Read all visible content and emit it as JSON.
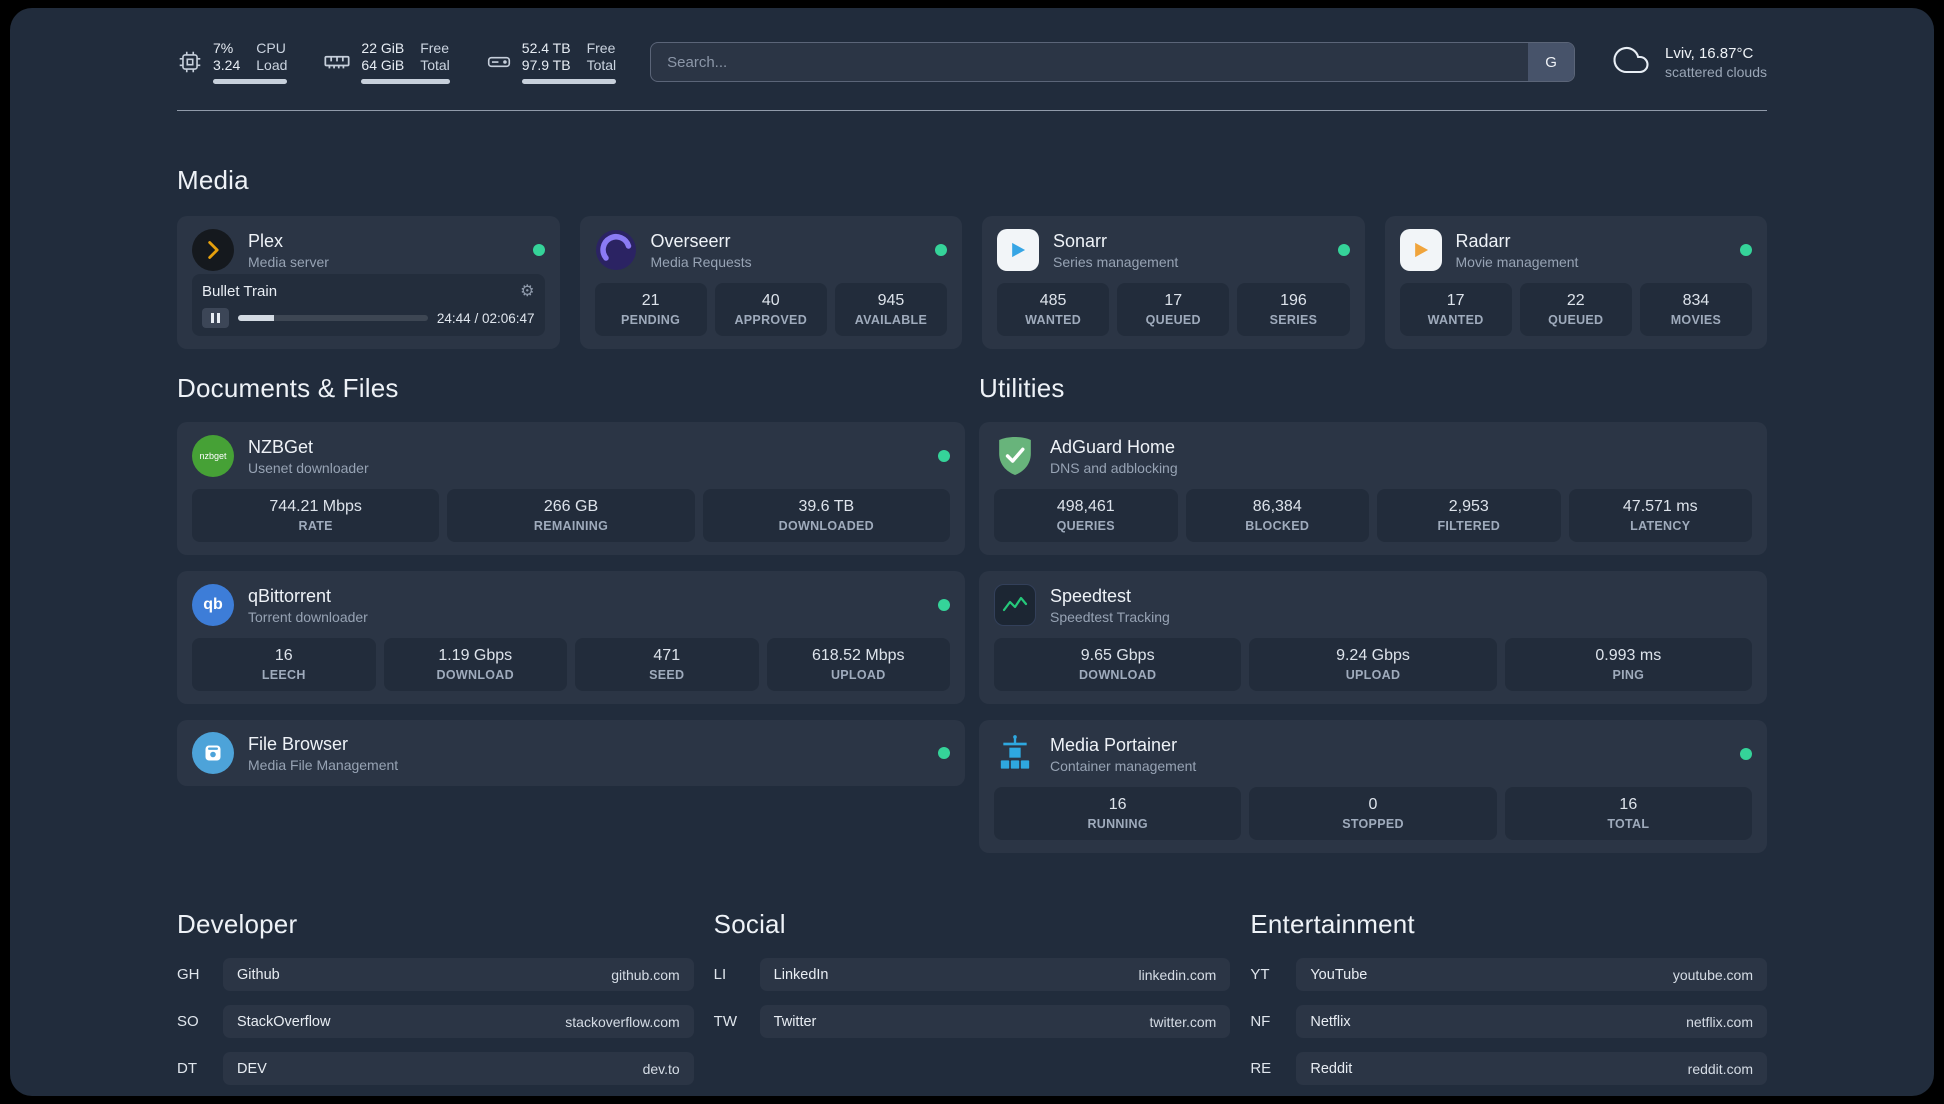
{
  "colors": {
    "background": "#212c3c",
    "card": "#2b3545",
    "tile": "#222c3b",
    "status_online": "#35d399",
    "plex_accent": "#e5a00d",
    "overseerr_accent": "#8b7bf4",
    "sonarr_accent": "#36a5e5",
    "radarr_accent": "#f0a43c",
    "nzbget_accent": "#46a136",
    "qbittorrent_accent": "#3d7dd8",
    "filebrowser_accent": "#4da3d9",
    "adguard_accent": "#68b47b",
    "speedtest_accent": "#25c87a",
    "portainer_accent": "#2ea8e0"
  },
  "topbar": {
    "cpu": {
      "value": "7%",
      "sub": "3.24",
      "label_top": "CPU",
      "label_bottom": "Load"
    },
    "memory": {
      "value": "22 GiB",
      "sub": "64 GiB",
      "label_top": "Free",
      "label_bottom": "Total"
    },
    "disk": {
      "value": "52.4 TB",
      "sub": "97.9 TB",
      "label_top": "Free",
      "label_bottom": "Total"
    },
    "search": {
      "placeholder": "Search...",
      "provider": "G"
    },
    "weather": {
      "location": "Lviv, 16.87°C",
      "condition": "scattered clouds"
    }
  },
  "media": {
    "title": "Media",
    "plex": {
      "name": "Plex",
      "subtitle": "Media server",
      "player": {
        "title": "Bullet Train",
        "time": "24:44 / 02:06:47"
      }
    },
    "overseerr": {
      "name": "Overseerr",
      "subtitle": "Media Requests",
      "stats": [
        {
          "value": "21",
          "label": "PENDING"
        },
        {
          "value": "40",
          "label": "APPROVED"
        },
        {
          "value": "945",
          "label": "AVAILABLE"
        }
      ]
    },
    "sonarr": {
      "name": "Sonarr",
      "subtitle": "Series management",
      "stats": [
        {
          "value": "485",
          "label": "WANTED"
        },
        {
          "value": "17",
          "label": "QUEUED"
        },
        {
          "value": "196",
          "label": "SERIES"
        }
      ]
    },
    "radarr": {
      "name": "Radarr",
      "subtitle": "Movie management",
      "stats": [
        {
          "value": "17",
          "label": "WANTED"
        },
        {
          "value": "22",
          "label": "QUEUED"
        },
        {
          "value": "834",
          "label": "MOVIES"
        }
      ]
    }
  },
  "documents": {
    "title": "Documents & Files",
    "nzbget": {
      "name": "NZBGet",
      "subtitle": "Usenet downloader",
      "stats": [
        {
          "value": "744.21 Mbps",
          "label": "RATE"
        },
        {
          "value": "266 GB",
          "label": "REMAINING"
        },
        {
          "value": "39.6 TB",
          "label": "DOWNLOADED"
        }
      ]
    },
    "qbittorrent": {
      "name": "qBittorrent",
      "subtitle": "Torrent downloader",
      "stats": [
        {
          "value": "16",
          "label": "LEECH"
        },
        {
          "value": "1.19 Gbps",
          "label": "DOWNLOAD"
        },
        {
          "value": "471",
          "label": "SEED"
        },
        {
          "value": "618.52 Mbps",
          "label": "UPLOAD"
        }
      ]
    },
    "filebrowser": {
      "name": "File Browser",
      "subtitle": "Media File Management"
    }
  },
  "utilities": {
    "title": "Utilities",
    "adguard": {
      "name": "AdGuard Home",
      "subtitle": "DNS and adblocking",
      "stats": [
        {
          "value": "498,461",
          "label": "QUERIES"
        },
        {
          "value": "86,384",
          "label": "BLOCKED"
        },
        {
          "value": "2,953",
          "label": "FILTERED"
        },
        {
          "value": "47.571 ms",
          "label": "LATENCY"
        }
      ]
    },
    "speedtest": {
      "name": "Speedtest",
      "subtitle": "Speedtest Tracking",
      "stats": [
        {
          "value": "9.65 Gbps",
          "label": "DOWNLOAD"
        },
        {
          "value": "9.24 Gbps",
          "label": "UPLOAD"
        },
        {
          "value": "0.993 ms",
          "label": "PING"
        }
      ]
    },
    "portainer": {
      "name": "Media Portainer",
      "subtitle": "Container management",
      "stats": [
        {
          "value": "16",
          "label": "RUNNING"
        },
        {
          "value": "0",
          "label": "STOPPED"
        },
        {
          "value": "16",
          "label": "TOTAL"
        }
      ]
    }
  },
  "bookmarks": {
    "developer": {
      "title": "Developer",
      "items": [
        {
          "abbr": "GH",
          "name": "Github",
          "url": "github.com"
        },
        {
          "abbr": "SO",
          "name": "StackOverflow",
          "url": "stackoverflow.com"
        },
        {
          "abbr": "DT",
          "name": "DEV",
          "url": "dev.to"
        }
      ]
    },
    "social": {
      "title": "Social",
      "items": [
        {
          "abbr": "LI",
          "name": "LinkedIn",
          "url": "linkedin.com"
        },
        {
          "abbr": "TW",
          "name": "Twitter",
          "url": "twitter.com"
        }
      ]
    },
    "entertainment": {
      "title": "Entertainment",
      "items": [
        {
          "abbr": "YT",
          "name": "YouTube",
          "url": "youtube.com"
        },
        {
          "abbr": "NF",
          "name": "Netflix",
          "url": "netflix.com"
        },
        {
          "abbr": "RE",
          "name": "Reddit",
          "url": "reddit.com"
        }
      ]
    }
  }
}
